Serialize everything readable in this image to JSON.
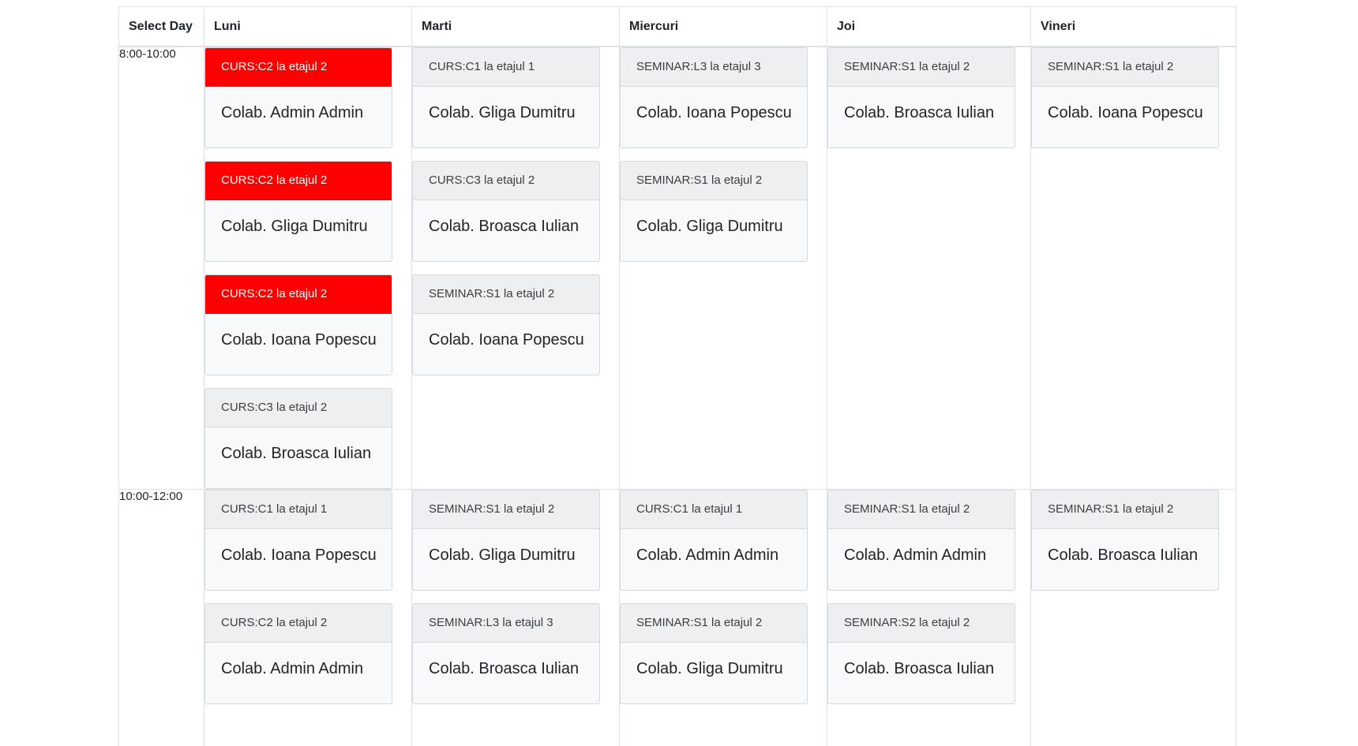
{
  "header": {
    "select_day": "Select Day",
    "days": [
      "Luni",
      "Marti",
      "Miercuri",
      "Joi",
      "Vineri"
    ]
  },
  "colors": {
    "highlight": "#ff0000",
    "card_bg": "#f8f9fa",
    "border": "#dee2e6"
  },
  "rows": [
    {
      "time": "8:00-10:00",
      "days": [
        [
          {
            "header": "CURS:C2 la etajul 2",
            "teacher": "Colab. Admin Admin",
            "highlight": true
          },
          {
            "header": "CURS:C2 la etajul 2",
            "teacher": "Colab. Gliga Dumitru",
            "highlight": true
          },
          {
            "header": "CURS:C2 la etajul 2",
            "teacher": "Colab. Ioana Popescu",
            "highlight": true
          },
          {
            "header": "CURS:C3 la etajul 2",
            "teacher": "Colab. Broasca Iulian",
            "highlight": false
          }
        ],
        [
          {
            "header": "CURS:C1 la etajul 1",
            "teacher": "Colab. Gliga Dumitru",
            "highlight": false
          },
          {
            "header": "CURS:C3 la etajul 2",
            "teacher": "Colab. Broasca Iulian",
            "highlight": false
          },
          {
            "header": "SEMINAR:S1 la etajul 2",
            "teacher": "Colab. Ioana Popescu",
            "highlight": false
          }
        ],
        [
          {
            "header": "SEMINAR:L3 la etajul 3",
            "teacher": "Colab. Ioana Popescu",
            "highlight": false
          },
          {
            "header": "SEMINAR:S1 la etajul 2",
            "teacher": "Colab. Gliga Dumitru",
            "highlight": false
          }
        ],
        [
          {
            "header": "SEMINAR:S1 la etajul 2",
            "teacher": "Colab. Broasca Iulian",
            "highlight": false
          }
        ],
        [
          {
            "header": "SEMINAR:S1 la etajul 2",
            "teacher": "Colab. Ioana Popescu",
            "highlight": false
          }
        ]
      ]
    },
    {
      "time": "10:00-12:00",
      "days": [
        [
          {
            "header": "CURS:C1 la etajul 1",
            "teacher": "Colab. Ioana Popescu",
            "highlight": false
          },
          {
            "header": "CURS:C2 la etajul 2",
            "teacher": "Colab. Admin Admin",
            "highlight": false
          }
        ],
        [
          {
            "header": "SEMINAR:S1 la etajul 2",
            "teacher": "Colab. Gliga Dumitru",
            "highlight": false
          },
          {
            "header": "SEMINAR:L3 la etajul 3",
            "teacher": "Colab. Broasca Iulian",
            "highlight": false
          }
        ],
        [
          {
            "header": "CURS:C1 la etajul 1",
            "teacher": "Colab. Admin Admin",
            "highlight": false
          },
          {
            "header": "SEMINAR:S1 la etajul 2",
            "teacher": "Colab. Gliga Dumitru",
            "highlight": false
          }
        ],
        [
          {
            "header": "SEMINAR:S1 la etajul 2",
            "teacher": "Colab. Admin Admin",
            "highlight": false
          },
          {
            "header": "SEMINAR:S2 la etajul 2",
            "teacher": "Colab. Broasca Iulian",
            "highlight": false
          }
        ],
        [
          {
            "header": "SEMINAR:S1 la etajul 2",
            "teacher": "Colab. Broasca Iulian",
            "highlight": false
          }
        ]
      ]
    }
  ]
}
